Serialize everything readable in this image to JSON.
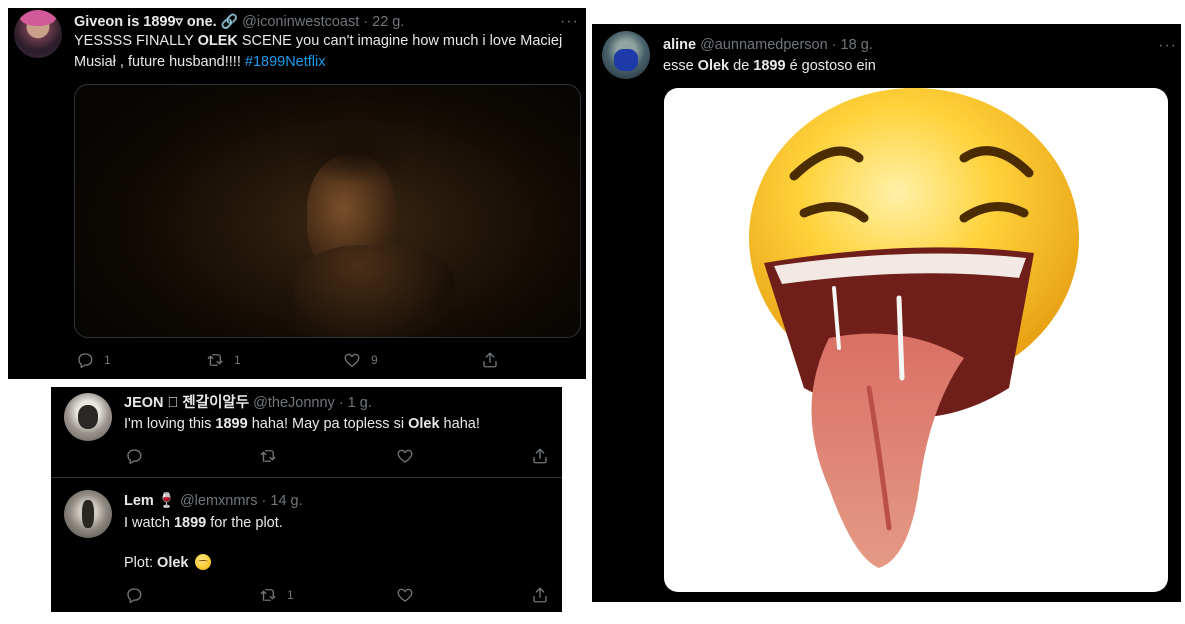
{
  "tweet1": {
    "display_name": "Giveon is 1899▿ one.",
    "handle": "@iconinwestcoast",
    "time": "· 22 g.",
    "text_a": "YESSSS FINALLY ",
    "text_b": "OLEK",
    "text_c": " SCENE you can't imagine how much i love Maciej Musiał , future husband!!!! ",
    "hashtag": "#1899Netflix",
    "reply_count": "1",
    "retweet_count": "1",
    "like_count": "9"
  },
  "tweet2": {
    "display_name": "JEON  젠갈이알두",
    "handle": "@theJonnny",
    "time": "· 1 g.",
    "text_a": "I'm loving this ",
    "text_b": "1899",
    "text_c": " haha! May pa topless si ",
    "text_d": "Olek",
    "text_e": " haha!"
  },
  "tweet3": {
    "display_name": "Lem",
    "handle": "@lemxnmrs",
    "time": "· 14 g.",
    "line1_a": "I watch ",
    "line1_b": "1899",
    "line1_c": " for the plot.",
    "line2_a": "Plot: ",
    "line2_b": "Olek",
    "retweet_count": "1"
  },
  "tweet4": {
    "display_name": "aline",
    "handle": "@aunnamedperson",
    "time": "· 18 g.",
    "text_a": "esse ",
    "text_b": "Olek",
    "text_c": " de ",
    "text_d": "1899",
    "text_e": " é gostoso ein"
  },
  "more_label": "···",
  "icons": [
    "reply-icon",
    "retweet-icon",
    "like-icon",
    "share-icon",
    "link-icon",
    "wine-glass-icon",
    "apple-icon",
    "emoji-icon"
  ],
  "colors": {
    "background": "#000000",
    "text": "#e7e9ea",
    "muted": "#71767b",
    "link": "#1d9bf0"
  }
}
